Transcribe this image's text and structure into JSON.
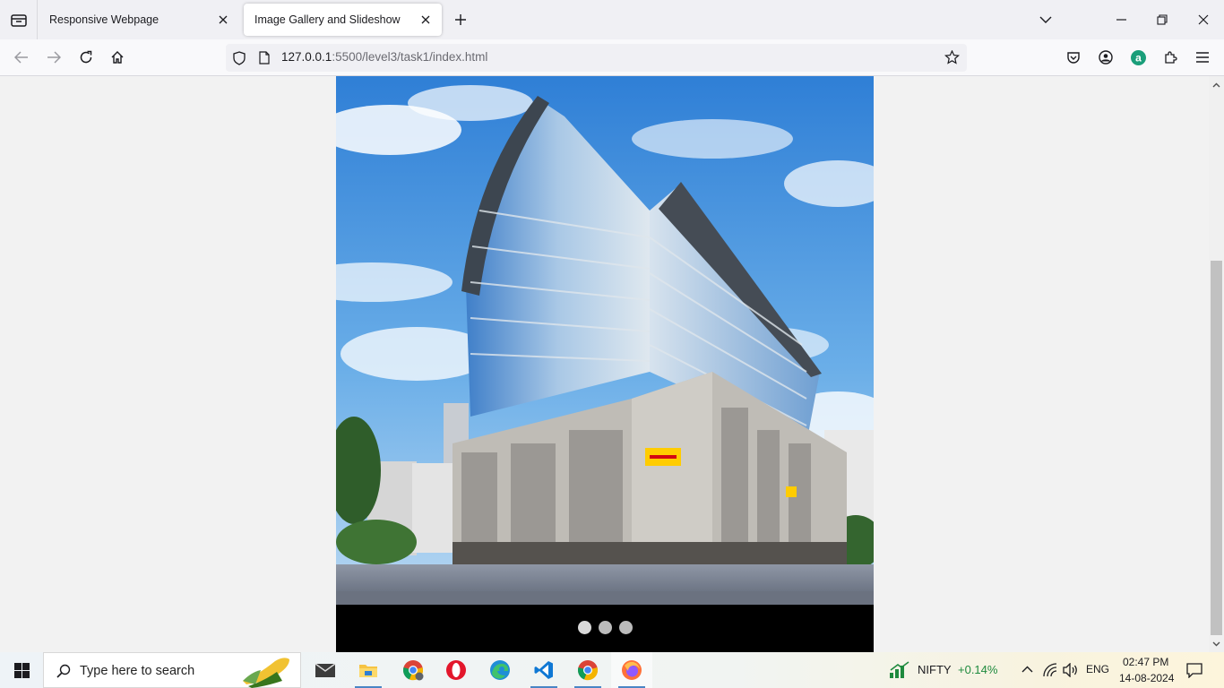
{
  "browser": {
    "tabs": [
      {
        "title": "Responsive Webpage",
        "active": false
      },
      {
        "title": "Image Gallery and Slideshow",
        "active": true
      }
    ],
    "url": {
      "host": "127.0.0.1",
      "path": ":5500/level3/task1/index.html"
    }
  },
  "slideshow": {
    "current_image": "DHL office building under blue sky",
    "dots": [
      {
        "active": true
      },
      {
        "active": false
      },
      {
        "active": false
      }
    ]
  },
  "taskbar": {
    "search_placeholder": "Type here to search",
    "apps": [
      "mail",
      "file-explorer",
      "chrome",
      "opera",
      "edge",
      "vscode",
      "chrome-profile",
      "firefox"
    ],
    "stock": {
      "name": "NIFTY",
      "change": "+0.14%"
    },
    "language": "ENG",
    "time": "02:47 PM",
    "date": "14-08-2024"
  },
  "colors": {
    "stock_green": "#1e8a3e",
    "tab_active_bg": "#ffffff",
    "amazon_badge": "#1a9e7a"
  }
}
